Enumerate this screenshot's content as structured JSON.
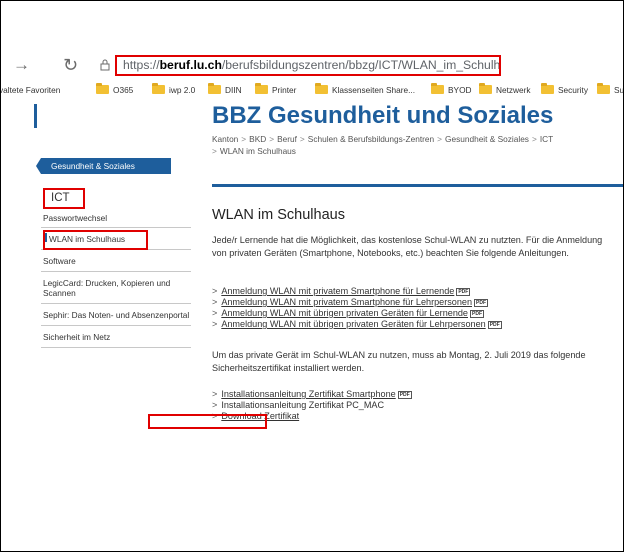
{
  "browser": {
    "back_icon": "→",
    "reload_icon": "↻",
    "url": {
      "prefix": "https://",
      "domain": "beruf.lu.ch",
      "path": "/berufsbildungszentren/bbzg/ICT/WLAN_im_Schulhaus"
    },
    "bookmarks": [
      "valtete Favoriten",
      "O365",
      "iwp 2.0",
      "DIIN",
      "Printer",
      "Klassenseiten Share...",
      "BYOD",
      "Netzwerk",
      "Security",
      "Supp"
    ]
  },
  "sidebar": {
    "home_button": "Gesundheit & Soziales",
    "heading": "ICT",
    "items": [
      {
        "label": "Passwortwechsel"
      },
      {
        "label": "WLAN im Schulhaus"
      },
      {
        "label": "Software"
      },
      {
        "label": "LegicCard: Drucken, Kopieren und Scannen"
      },
      {
        "label": "Sephir: Das Noten- und Absenzenportal"
      },
      {
        "label": "Sicherheit im Netz"
      }
    ]
  },
  "main": {
    "site_title": "BBZ Gesundheit und Soziales",
    "breadcrumb": [
      "Kanton",
      "BKD",
      "Beruf",
      "Schulen & Berufsbildungs-Zentren",
      "Gesundheit & Soziales",
      "ICT",
      "WLAN im Schulhaus"
    ],
    "heading": "WLAN im Schulhaus",
    "intro": "Jede/r Lernende hat die Möglichkeit, das kostenlose Schul-WLAN zu nutzten. Für die Anmeldung von privaten Geräten (Smartphone, Notebooks, etc.) beachten Sie folgende Anleitungen.",
    "links": [
      "Anmeldung WLAN mit privatem Smartphone für Lernende",
      "Anmeldung WLAN mit privatem Smartphone für Lehrpersonen",
      "Anmeldung WLAN mit übrigen privaten Geräten für Lernende",
      "Anmeldung WLAN mit übrigen privaten Geräten für Lehrpersonen"
    ],
    "notice": "Um das private Gerät im Schul-WLAN zu nutzen, muss ab Montag, 2. Juli 2019 das folgende Sicherheitszertifikat installiert werden.",
    "cert_links": [
      "Installationsanleitung Zertifikat Smartphone",
      "Installationsanleitung Zertifikat PC_MAC",
      "Download Zertifikat"
    ],
    "pdf_badge": "PDF",
    "chevron": ">"
  },
  "colors": {
    "brand_blue": "#1e5e9c",
    "highlight_red": "#e00000",
    "folder_yellow": "#f2c033"
  }
}
